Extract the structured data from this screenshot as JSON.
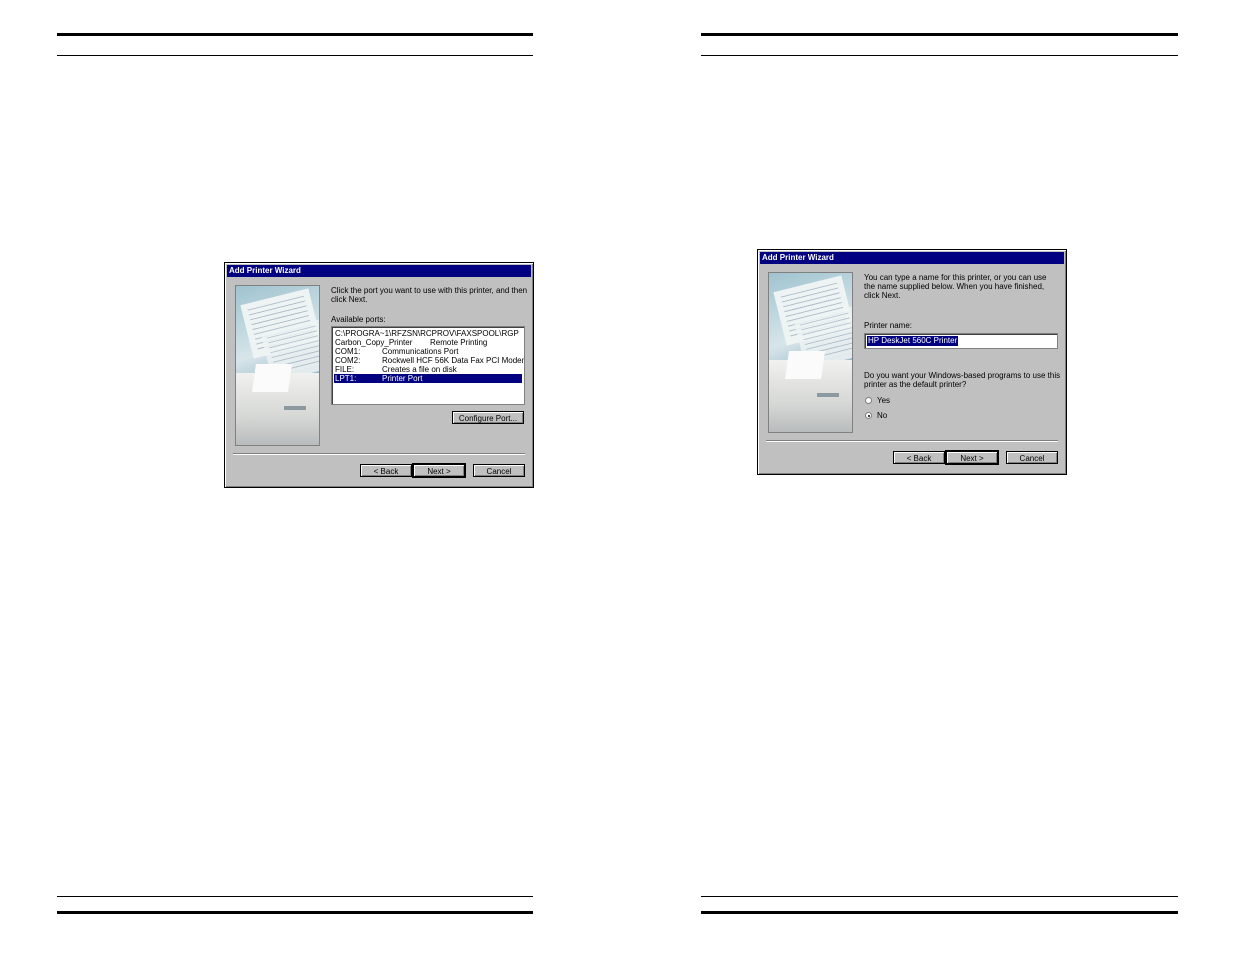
{
  "left_page": {
    "dialog": {
      "title": "Add Printer Wizard",
      "instruction_line1": "Click the port you want to use with this printer, and then",
      "instruction_line2": "click Next.",
      "ports_label": "Available ports:",
      "ports": [
        {
          "name": "C:\\PROGRA~1\\RFZSN\\RCPROV\\FAXSPOOL\\RGP",
          "desc": "",
          "selected": false
        },
        {
          "name": "Carbon_Copy_Printer",
          "desc": "Remote Printing",
          "selected": false
        },
        {
          "name": "COM1:",
          "desc": "Communications Port",
          "selected": false
        },
        {
          "name": "COM2:",
          "desc": "Rockwell HCF 56K Data Fax PCI Modem",
          "selected": false
        },
        {
          "name": "FILE:",
          "desc": "Creates a file on disk",
          "selected": false
        },
        {
          "name": "LPT1:",
          "desc": "Printer Port",
          "selected": true
        }
      ],
      "configure_button": "Configure Port...",
      "back_button": "< Back",
      "next_button": "Next >",
      "cancel_button": "Cancel"
    }
  },
  "right_page": {
    "dialog": {
      "title": "Add Printer Wizard",
      "instruction_line1": "You can type a name for this printer, or you can use",
      "instruction_line2": "the name supplied below. When you have finished,",
      "instruction_line3": "click Next.",
      "printer_name_label": "Printer name:",
      "printer_name_value": "HP DeskJet 560C Printer",
      "default_question_line1": "Do you want your Windows-based programs to use this",
      "default_question_line2": "printer as the default printer?",
      "option_yes": "Yes",
      "option_no": "No",
      "selected_option": "No",
      "back_button": "< Back",
      "next_button": "Next >",
      "cancel_button": "Cancel"
    }
  },
  "colors": {
    "titlebar": "#000080",
    "dialog_face": "#c0c0c0",
    "selection": "#000080"
  }
}
